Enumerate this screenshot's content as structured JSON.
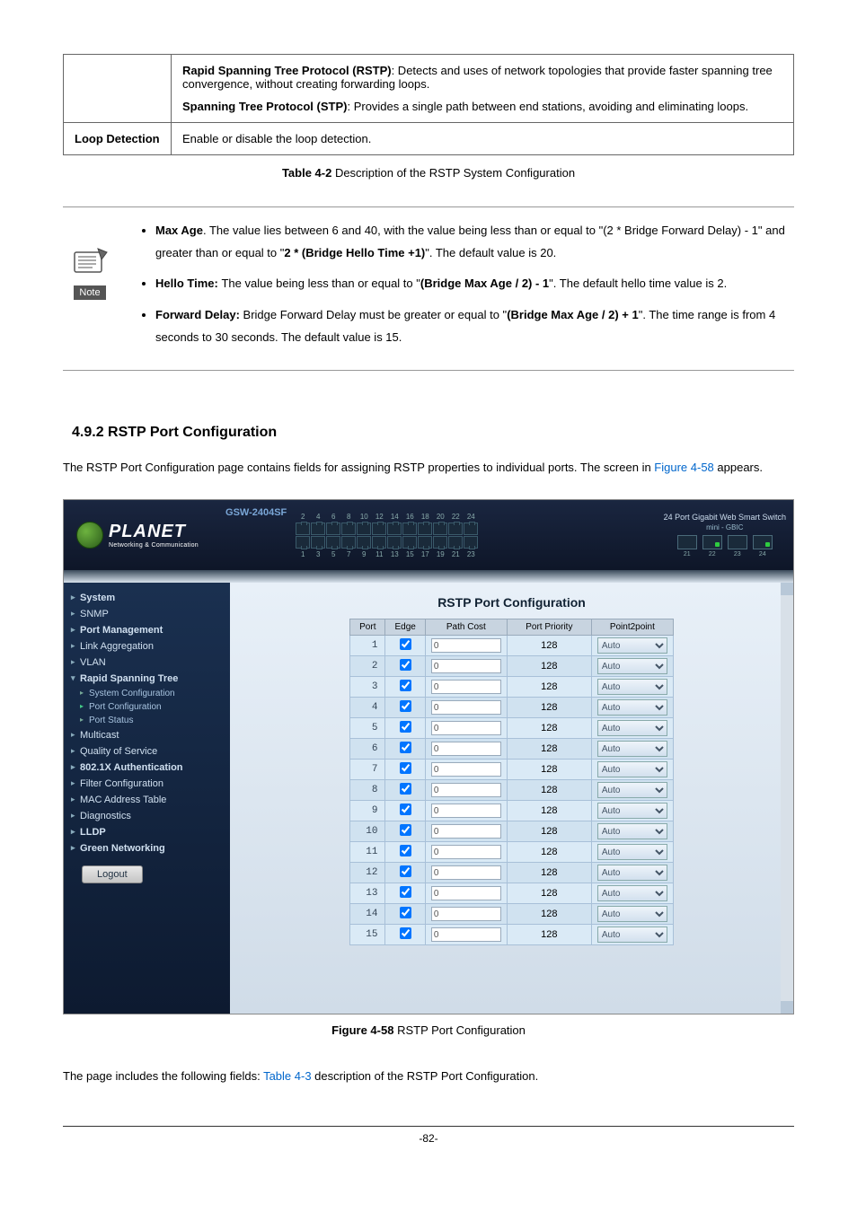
{
  "desc_table": {
    "rows": [
      {
        "col1": "",
        "col2_parts": {
          "rstp_label": "Rapid Spanning Tree Protocol (RSTP)",
          "rstp_text": ": Detects and uses of network topologies that provide faster spanning tree convergence, without creating forwarding loops.",
          "stp_label": "Spanning Tree Protocol (STP)",
          "stp_text": ": Provides a single path between end stations, avoiding and eliminating loops."
        }
      },
      {
        "col1": "Loop Detection",
        "col2": "Enable or disable the loop detection."
      }
    ]
  },
  "table_caption_prefix": "Table 4-2",
  "table_caption_text": " Description of the RSTP System Configuration",
  "note": {
    "icon_label": "Note",
    "items": [
      {
        "label": "Max Age",
        "text": ". The value lies between 6 and 40, with the value being less than or equal to \"(2 * Bridge Forward Delay) - 1\" and greater than or equal to \"",
        "mid": "2 * (Bridge Hello Time +1)",
        "tail": "\". The default value is 20."
      },
      {
        "label": "Hello Time: ",
        "text": "The value being less than or equal to \"",
        "mid": "(Bridge Max Age / 2) - 1",
        "tail": "\". The default hello time value is 2."
      },
      {
        "label": "Forward Delay: ",
        "text": "Bridge Forward Delay must be greater or equal to \"",
        "mid": "(Bridge Max Age / 2) + 1",
        "tail": "\". The time range is from 4 seconds to 30 seconds. The default value is 15."
      }
    ]
  },
  "section_heading": "4.9.2 RSTP Port Configuration",
  "body_text_a": "The RSTP Port Configuration page contains fields for assigning RSTP properties to individual ports. The screen in ",
  "body_link": "Figure 4-58",
  "body_text_b": " appears.",
  "device": {
    "model": "GSW-2404SF",
    "brand_main": "PLANET",
    "brand_sub": "Networking & Communication",
    "title_right": "24 Port Gigabit Web Smart Switch",
    "subtitle_right": "mini - GBIC",
    "port_tops": [
      "2",
      "4",
      "6",
      "8",
      "10",
      "12",
      "14",
      "16",
      "18",
      "20",
      "22",
      "24"
    ],
    "port_bots": [
      "1",
      "3",
      "5",
      "7",
      "9",
      "11",
      "13",
      "15",
      "17",
      "19",
      "21",
      "23"
    ],
    "sfp_nums": [
      "21",
      "22",
      "23",
      "24"
    ]
  },
  "sidebar": {
    "items": [
      {
        "label": "System",
        "cls": "nav-item bold"
      },
      {
        "label": "SNMP",
        "cls": "nav-item"
      },
      {
        "label": "Port Management",
        "cls": "nav-item bold"
      },
      {
        "label": "Link Aggregation",
        "cls": "nav-item"
      },
      {
        "label": "VLAN",
        "cls": "nav-item"
      },
      {
        "label": "Rapid Spanning Tree",
        "cls": "nav-item bold expanded"
      },
      {
        "label": "System Configuration",
        "cls": "nav-sub"
      },
      {
        "label": "Port Configuration",
        "cls": "nav-sub active"
      },
      {
        "label": "Port Status",
        "cls": "nav-sub"
      },
      {
        "label": "Multicast",
        "cls": "nav-item"
      },
      {
        "label": "Quality of Service",
        "cls": "nav-item"
      },
      {
        "label": "802.1X Authentication",
        "cls": "nav-item bold"
      },
      {
        "label": "Filter Configuration",
        "cls": "nav-item"
      },
      {
        "label": "MAC Address Table",
        "cls": "nav-item"
      },
      {
        "label": "Diagnostics",
        "cls": "nav-item"
      },
      {
        "label": "LLDP",
        "cls": "nav-item bold"
      },
      {
        "label": "Green Networking",
        "cls": "nav-item bold"
      }
    ],
    "logout": "Logout"
  },
  "content": {
    "title": "RSTP Port Configuration",
    "headers": [
      "Port",
      "Edge",
      "Path Cost",
      "Port Priority",
      "Point2point"
    ],
    "rows": [
      {
        "port": "1",
        "edge": true,
        "path": "0",
        "pri": "128",
        "p2p": "Auto"
      },
      {
        "port": "2",
        "edge": true,
        "path": "0",
        "pri": "128",
        "p2p": "Auto"
      },
      {
        "port": "3",
        "edge": true,
        "path": "0",
        "pri": "128",
        "p2p": "Auto"
      },
      {
        "port": "4",
        "edge": true,
        "path": "0",
        "pri": "128",
        "p2p": "Auto"
      },
      {
        "port": "5",
        "edge": true,
        "path": "0",
        "pri": "128",
        "p2p": "Auto"
      },
      {
        "port": "6",
        "edge": true,
        "path": "0",
        "pri": "128",
        "p2p": "Auto"
      },
      {
        "port": "7",
        "edge": true,
        "path": "0",
        "pri": "128",
        "p2p": "Auto"
      },
      {
        "port": "8",
        "edge": true,
        "path": "0",
        "pri": "128",
        "p2p": "Auto"
      },
      {
        "port": "9",
        "edge": true,
        "path": "0",
        "pri": "128",
        "p2p": "Auto"
      },
      {
        "port": "10",
        "edge": true,
        "path": "0",
        "pri": "128",
        "p2p": "Auto"
      },
      {
        "port": "11",
        "edge": true,
        "path": "0",
        "pri": "128",
        "p2p": "Auto"
      },
      {
        "port": "12",
        "edge": true,
        "path": "0",
        "pri": "128",
        "p2p": "Auto"
      },
      {
        "port": "13",
        "edge": true,
        "path": "0",
        "pri": "128",
        "p2p": "Auto"
      },
      {
        "port": "14",
        "edge": true,
        "path": "0",
        "pri": "128",
        "p2p": "Auto"
      },
      {
        "port": "15",
        "edge": true,
        "path": "0",
        "pri": "128",
        "p2p": "Auto"
      }
    ]
  },
  "fig_caption_prefix": "Figure 4-58",
  "fig_caption_text": " RSTP Port Configuration",
  "footer_text_a": "The page includes the following fields: ",
  "footer_link": "Table 4-3",
  "footer_text_b": " description of the RSTP Port Configuration.",
  "page_num": "-82-"
}
